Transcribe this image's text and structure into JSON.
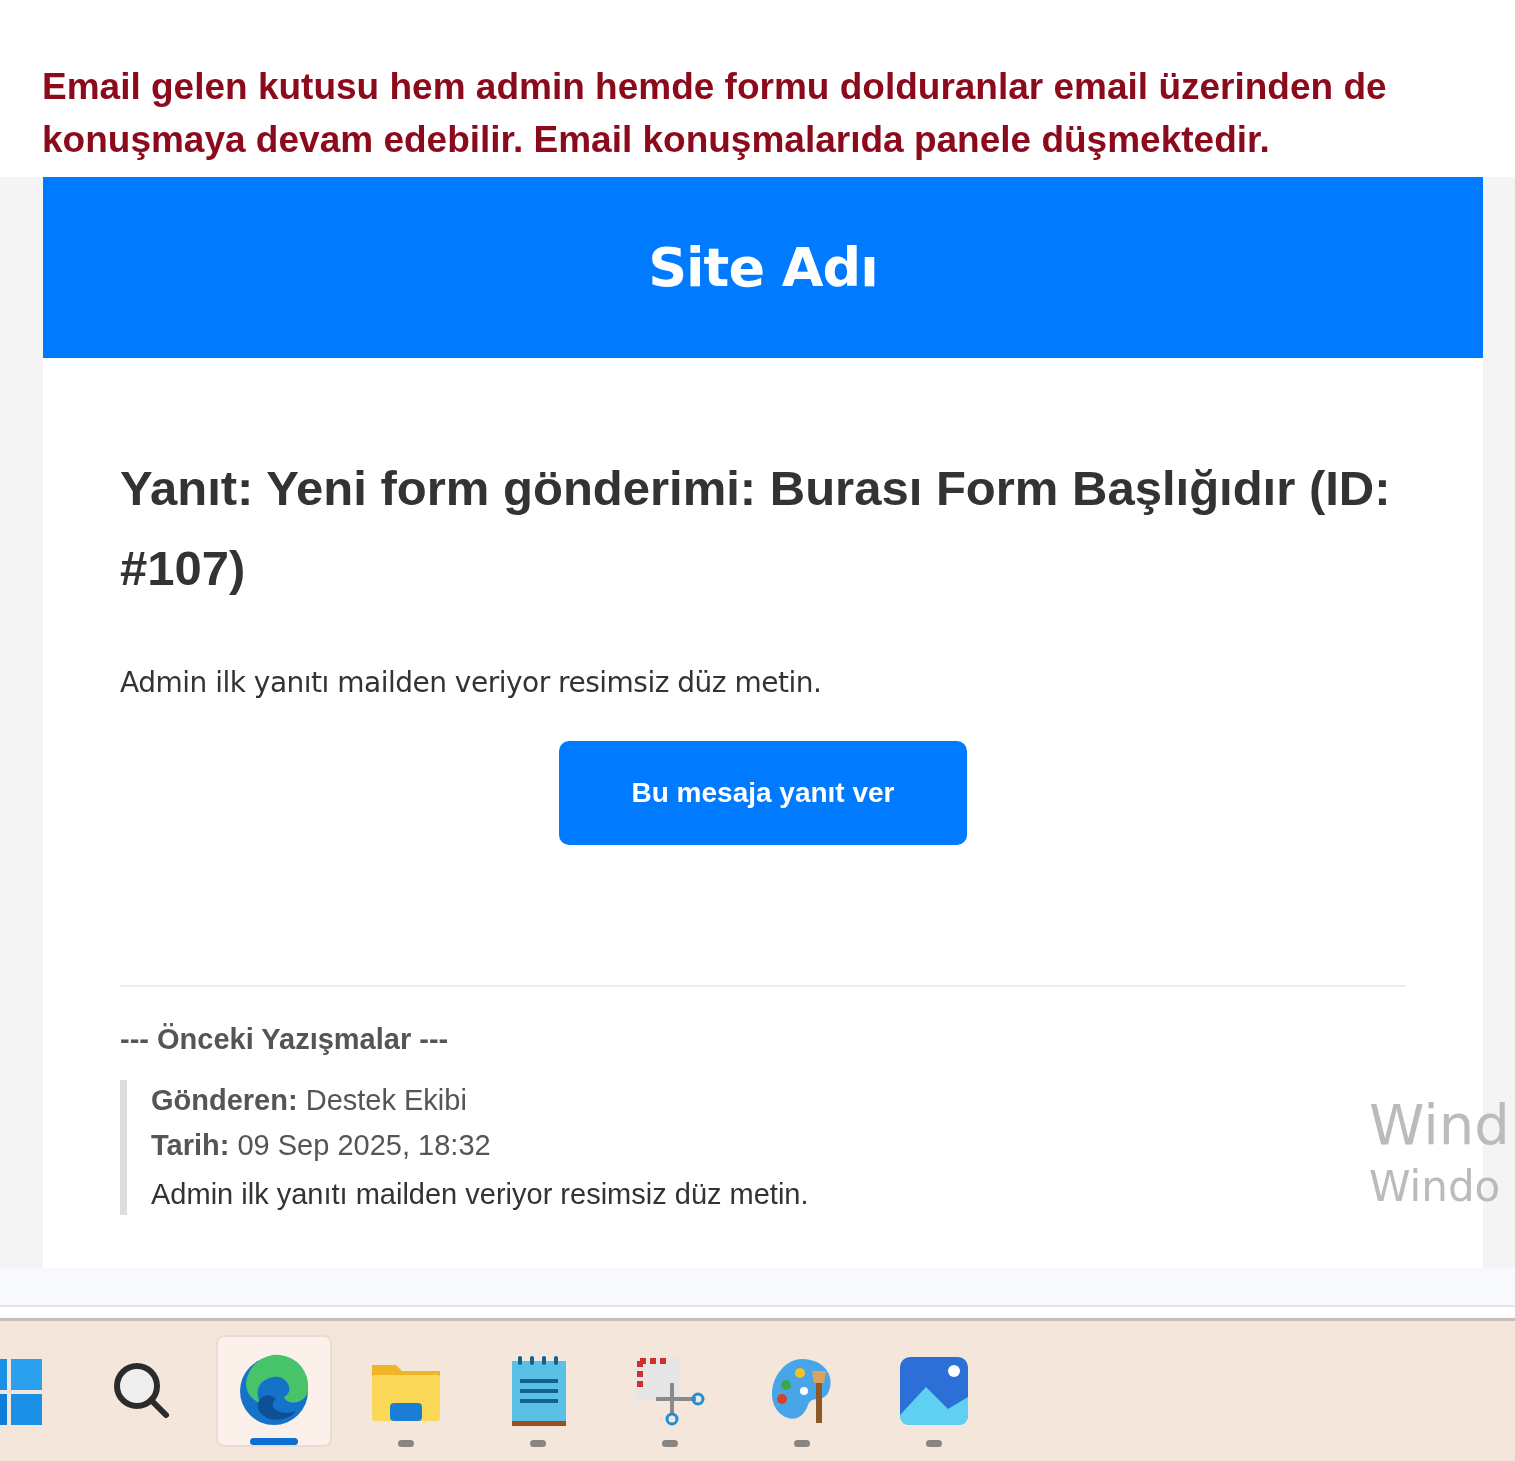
{
  "caption": "Email gelen kutusu hem admin hemde formu dolduranlar email üzerinden de konuşmaya devam edebilir. Email konuşmalarıda panele düşmektedir.",
  "email": {
    "site_name": "Site Adı",
    "subject": "Yanıt: Yeni form gönderimi: Burası Form Başlığıdır (ID: #107)",
    "body": "Admin ilk yanıtı mailden veriyor resimsiz düz metin.",
    "button": "Bu mesaja yanıt ver",
    "history_heading": "--- Önceki Yazışmalar ---",
    "history": [
      {
        "sender_label": "Gönderen:",
        "sender": "Destek Ekibi",
        "date_label": "Tarih:",
        "date": "09 Sep 2025, 18:32",
        "message": "Admin ilk yanıtı mailden veriyor resimsiz düz metin."
      }
    ]
  },
  "activation_notice": [
    "Wind",
    "Windo"
  ],
  "taskbar": [
    {
      "kind": "start",
      "running": false,
      "selected": false
    },
    {
      "kind": "search",
      "running": false,
      "selected": false
    },
    {
      "kind": "browser",
      "running": true,
      "selected": true
    },
    {
      "kind": "folder",
      "running": true,
      "selected": false
    },
    {
      "kind": "notepad",
      "running": true,
      "selected": false
    },
    {
      "kind": "snip",
      "running": true,
      "selected": false
    },
    {
      "kind": "paint",
      "running": true,
      "selected": false
    },
    {
      "kind": "photos",
      "running": true,
      "selected": false
    }
  ]
}
